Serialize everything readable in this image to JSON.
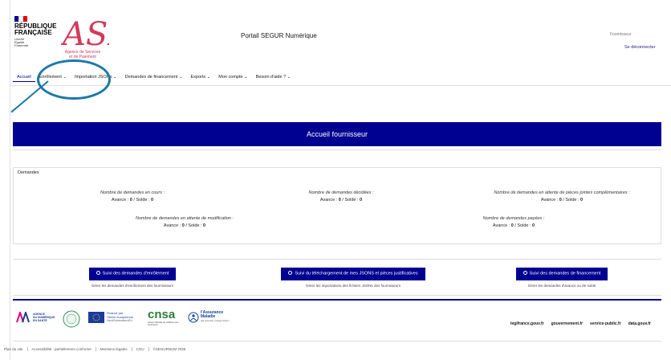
{
  "header": {
    "gov_title_line1": "RÉPUBLIQUE",
    "gov_title_line2": "FRANÇAISE",
    "gov_motto": "Liberté Égalité Fraternité",
    "asp_logo_text": "ASP",
    "asp_caption_line1": "Agence de Services",
    "asp_caption_line2": "et de Paiement",
    "portal_title": "Portail SEGUR Numérique",
    "user_role": "Fournisseur",
    "logout_label": "Se déconnecter"
  },
  "nav": {
    "items": [
      {
        "label": "Accueil"
      },
      {
        "label": "Enrôlement ⌄"
      },
      {
        "label": "Importation JSONs ⌄"
      },
      {
        "label": "Demandes de financement ⌄"
      },
      {
        "label": "Exports ⌄"
      },
      {
        "label": "Mon compte ⌄"
      },
      {
        "label": "Besoin d'aide ? ⌄"
      }
    ]
  },
  "banner": {
    "title": "Accueil fournisseur"
  },
  "demandes": {
    "title": "Demandes",
    "stats": [
      {
        "label": "Nombre de demandes en cours :",
        "avance_label": "Avance :",
        "avance": "0",
        "solde_label": "/ Solde :",
        "solde": "0"
      },
      {
        "label": "Nombre de demandes décidées :",
        "avance_label": "Avance :",
        "avance": "0",
        "solde_label": "/ Solde :",
        "solde": "0"
      },
      {
        "label": "Nombre de demandes en attente de pièces jointes complémentaires :",
        "avance_label": "Avance :",
        "avance": "0",
        "solde_label": "/ Solde :",
        "solde": "0"
      },
      {
        "label": "Nombre de demandes en attente de modification :",
        "avance_label": "Avance :",
        "avance": "0",
        "solde_label": "/ Solde :",
        "solde": "0"
      },
      {
        "label": "Nombre de demandes payées :",
        "avance_label": "Avance :",
        "avance": "0",
        "solde_label": "/ Solde :",
        "solde": "0"
      }
    ]
  },
  "actions": [
    {
      "label": "Suivi des demandes d'enrôlement",
      "sub": "Gérer les demandes d'enrôlement des fournisseurs"
    },
    {
      "label": "Suivi du téléchargement de mes JSONS et pièces justificatives",
      "sub": "Gérer les importations des fichiers JSONs des fournisseurs"
    },
    {
      "label": "Suivi des demandes de financement",
      "sub": "Gérer les demandes d'avance ou de solde"
    }
  ],
  "partners": {
    "ans_line1": "AGENCE",
    "ans_line2": "DU NUMÉRIQUE",
    "ans_line3": "EN SANTÉ",
    "ue_line1": "Financé par",
    "ue_line2": "l'Union européenne",
    "ue_line3": "NextGenerationEU",
    "cnsa_name": "cnsa",
    "cnsa_sub": "Caisse nationale de solidarité pour l'autonomie",
    "am_line1": "l'Assurance",
    "am_line2": "Maladie",
    "am_sub": "Agir ensemble, protéger chacun"
  },
  "footer": {
    "links": [
      "legifrance.gouv.fr",
      "gouvernement.fr",
      "service-public.fr",
      "data.gouv.fr"
    ],
    "bottom": [
      "Plan du site",
      "Accessibilité : partiellement conforme",
      "Mentions légales",
      "CGU",
      "©SEGURNUM 2026"
    ]
  },
  "colors": {
    "primary": "#000091",
    "asp_red": "#d33a5a",
    "annotation": "#1b78a8"
  }
}
